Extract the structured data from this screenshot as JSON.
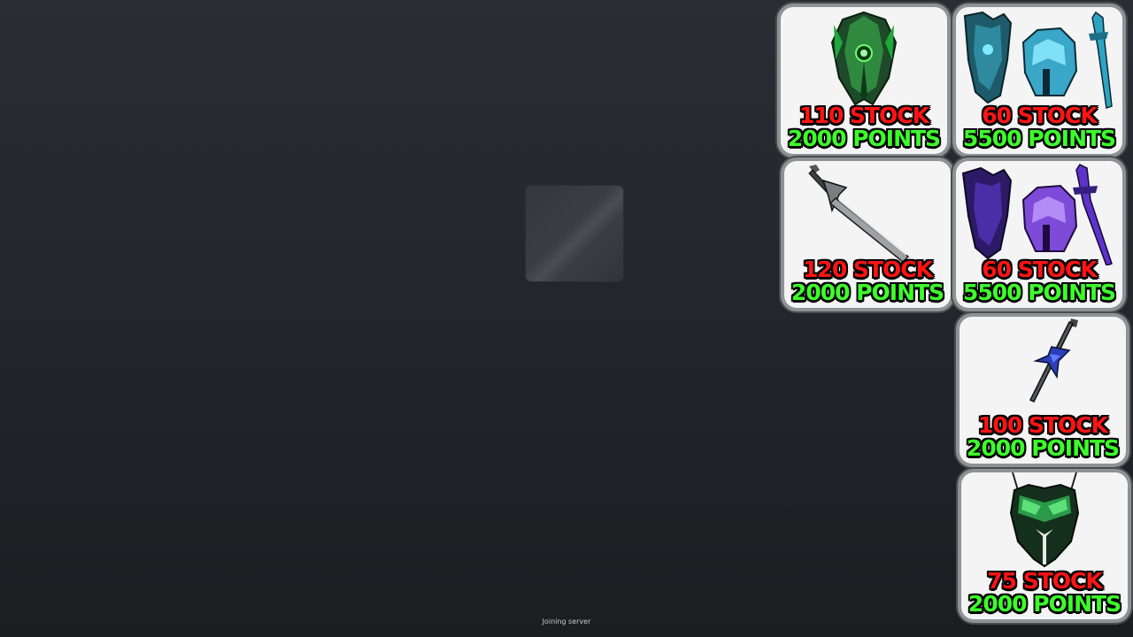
{
  "status": {
    "text": "Joining server"
  },
  "shop": {
    "items": [
      {
        "stock": "110 STOCK",
        "points": "2000 POINTS",
        "item_icon": "green-cape-icon",
        "accent": "#1fa83a"
      },
      {
        "stock": "60 STOCK",
        "points": "5500 POINTS",
        "item_icon": "cyan-armor-set-icon",
        "accent": "#3ec3dc"
      },
      {
        "stock": "120 STOCK",
        "points": "2000 POINTS",
        "item_icon": "gray-sword-icon",
        "accent": "#6b6e73"
      },
      {
        "stock": "60 STOCK",
        "points": "5500 POINTS",
        "item_icon": "purple-armor-set-icon",
        "accent": "#7a3fe0"
      },
      {
        "stock": "100 STOCK",
        "points": "2000 POINTS",
        "item_icon": "blue-spear-icon",
        "accent": "#2a3fb8"
      },
      {
        "stock": "75 STOCK",
        "points": "2000 POINTS",
        "item_icon": "green-helmet-icon",
        "accent": "#1b8f3a"
      }
    ]
  },
  "colors": {
    "stock_text": "#ff1414",
    "points_text": "#3cff2a",
    "card_bg": "#f4f4f4",
    "background": "#25282d"
  }
}
